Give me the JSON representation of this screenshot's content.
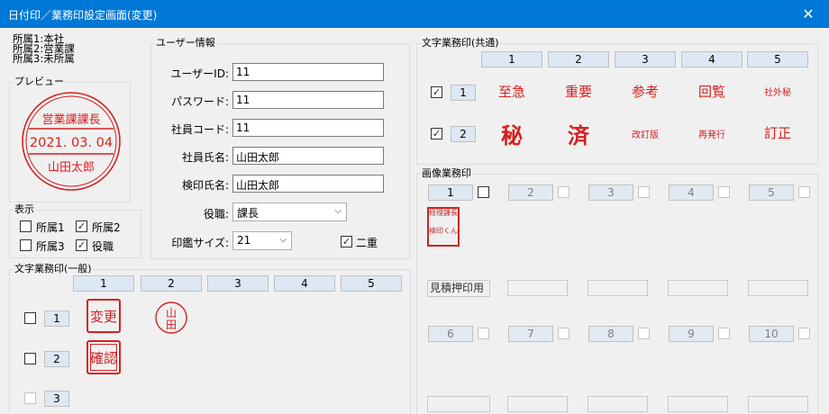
{
  "window": {
    "title": "日付印／業務印設定画面(変更)",
    "close_glyph": "✕"
  },
  "affiliations": [
    "所属1:本社",
    "所属2:営業課",
    "所属3:未所属"
  ],
  "preview": {
    "legend": "プレビュー",
    "top_text": "営業課課長",
    "date_text": "2021. 03. 04",
    "name_text": "山田太郎",
    "stamp_color": "#d42020"
  },
  "display": {
    "legend": "表示",
    "items": [
      {
        "label": "所属1",
        "checked": ""
      },
      {
        "label": "所属2",
        "checked": "✓"
      },
      {
        "label": "所属3",
        "checked": ""
      },
      {
        "label": "役職",
        "checked": "✓"
      }
    ]
  },
  "user_info": {
    "legend": "ユーザー情報",
    "fields": [
      {
        "label": "ユーザーID:",
        "value": "11"
      },
      {
        "label": "パスワード:",
        "value": "11"
      },
      {
        "label": "社員コード:",
        "value": "11"
      },
      {
        "label": "社員氏名:",
        "value": "山田太郎"
      },
      {
        "label": "検印氏名:",
        "value": "山田太郎"
      }
    ],
    "position_label": "役職:",
    "position_value": "課長",
    "size_label": "印鑑サイズ:",
    "size_value": "21",
    "double_label": "二重",
    "double_checked": "✓"
  },
  "text_stamp_general": {
    "legend": "文字業務印(一般)",
    "columns": [
      "1",
      "2",
      "3",
      "4",
      "5"
    ],
    "rows": [
      {
        "num": "1",
        "checked": ""
      },
      {
        "num": "2",
        "checked": ""
      },
      {
        "num": "3",
        "checked": ""
      }
    ],
    "stamps": {
      "change": "変更",
      "confirm": "確認",
      "yamada_top": "山",
      "yamada_bottom": "田"
    }
  },
  "text_stamp_common": {
    "legend": "文字業務印(共通)",
    "columns": [
      "1",
      "2",
      "3",
      "4",
      "5"
    ],
    "rows": [
      {
        "num": "1",
        "checked": "✓",
        "stamps": [
          "至急",
          "重要",
          "参考",
          "回覧",
          "社外秘"
        ]
      },
      {
        "num": "2",
        "checked": "✓",
        "stamps": [
          "秘",
          "済",
          "改訂版",
          "再発行",
          "訂正"
        ]
      }
    ]
  },
  "image_stamp": {
    "legend": "画像業務印",
    "row1_nums": [
      "1",
      "2",
      "3",
      "4",
      "5"
    ],
    "row2_nums": [
      "6",
      "7",
      "8",
      "9",
      "10"
    ],
    "slot1_label": "見積押印用",
    "slot1_seal": [
      "経理",
      "課長",
      "検印",
      "くん"
    ]
  }
}
